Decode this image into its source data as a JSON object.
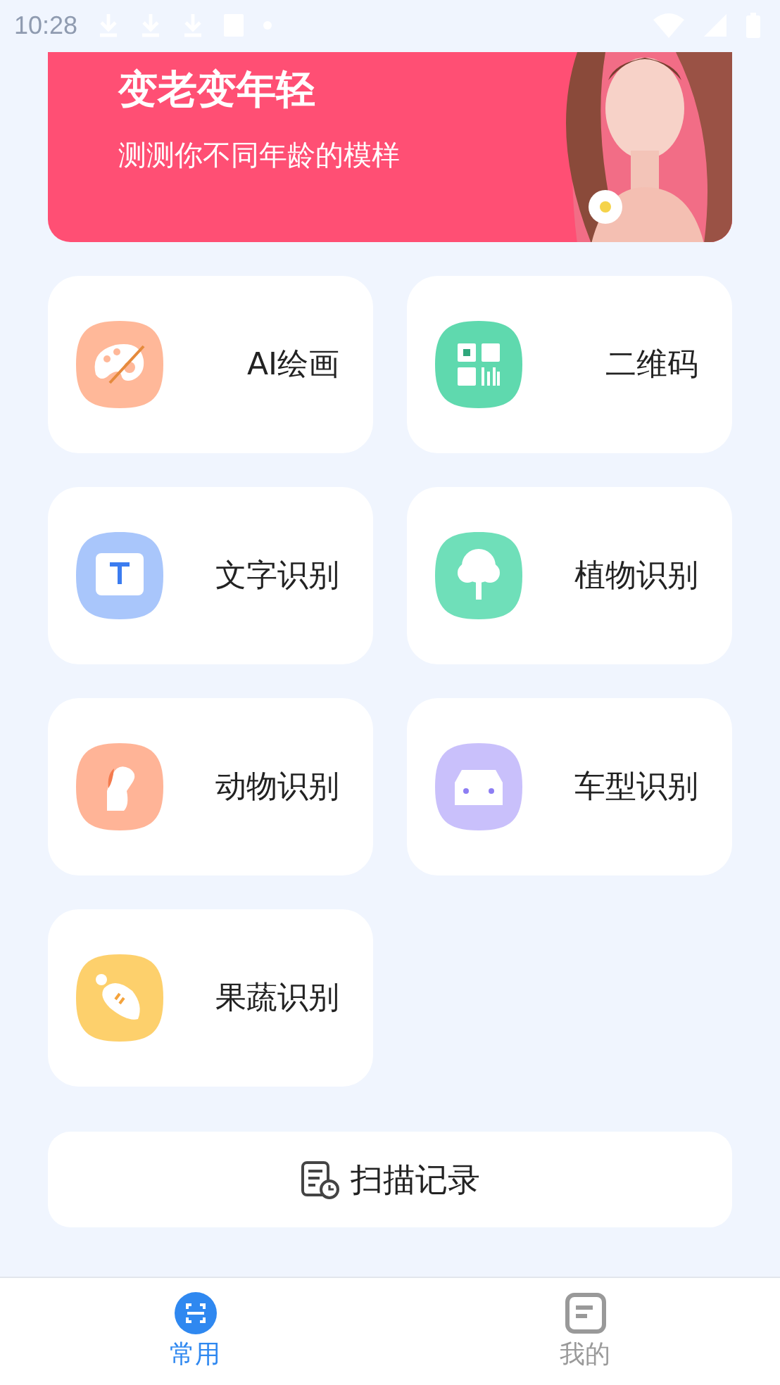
{
  "status_bar": {
    "time": "10:28"
  },
  "banner": {
    "title": "变老变年轻",
    "subtitle": "测测你不同年龄的模样"
  },
  "tools": [
    {
      "label": "AI绘画",
      "kind": "palette",
      "color": "#ffb899"
    },
    {
      "label": "二维码",
      "kind": "qrcode",
      "color": "#5fd9ae"
    },
    {
      "label": "文字识别",
      "kind": "text",
      "color": "#a9c6fb"
    },
    {
      "label": "植物识别",
      "kind": "tree",
      "color": "#6fdfb9"
    },
    {
      "label": "动物识别",
      "kind": "dog",
      "color": "#ffb497"
    },
    {
      "label": "车型识别",
      "kind": "car",
      "color": "#c9c0fb"
    },
    {
      "label": "果蔬识别",
      "kind": "carrot",
      "color": "#fdd06c"
    }
  ],
  "history_button": {
    "label": "扫描记录"
  },
  "tab_bar": [
    {
      "label": "常用",
      "kind": "scan",
      "selected": true
    },
    {
      "label": "我的",
      "kind": "doc",
      "selected": false
    }
  ]
}
